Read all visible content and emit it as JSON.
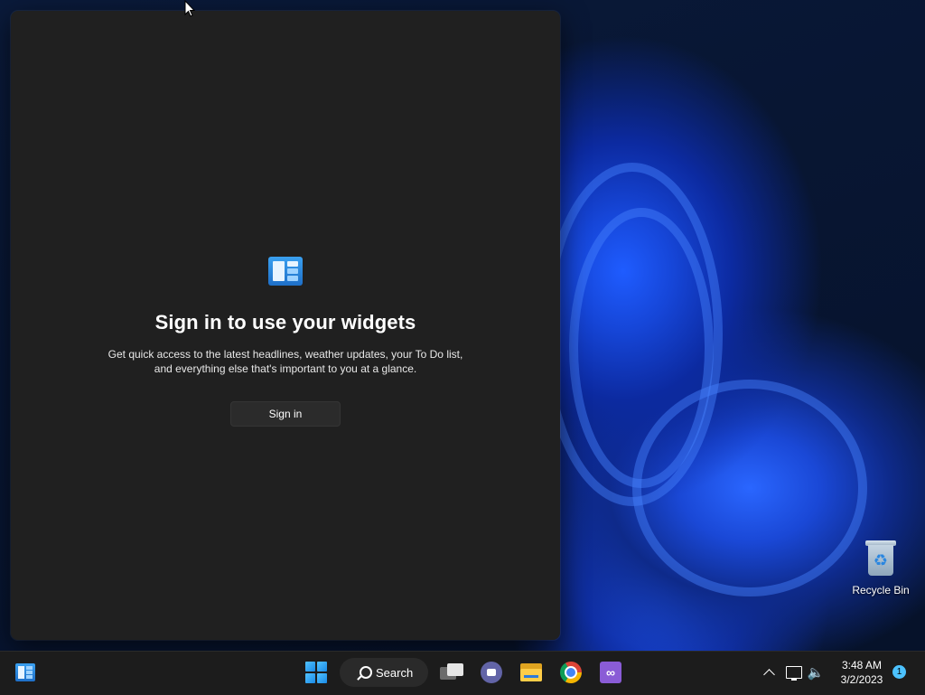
{
  "widgets_panel": {
    "title": "Sign in to use your widgets",
    "description": "Get quick access to the latest headlines, weather updates, your To Do list, and everything else that's important to you at a glance.",
    "sign_in_label": "Sign in",
    "icon": "widgets-icon"
  },
  "desktop": {
    "recycle_bin_label": "Recycle Bin"
  },
  "taskbar": {
    "search_label": "Search",
    "pinned": [
      "widgets-icon",
      "start-icon",
      "search-icon",
      "task-view-icon",
      "chat-icon",
      "file-explorer-icon",
      "chrome-icon",
      "visual-studio-icon"
    ],
    "tray": {
      "time": "3:48 AM",
      "date": "3/2/2023",
      "notification_count": "1"
    }
  },
  "colors": {
    "panel_bg": "#202020",
    "taskbar_bg": "#1c1c1c",
    "accent": "#4cc2ff"
  }
}
